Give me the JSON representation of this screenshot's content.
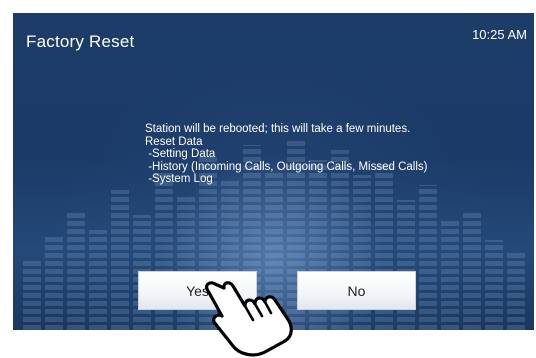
{
  "header": {
    "title": "Factory Reset",
    "time": "10:25 AM"
  },
  "message": {
    "lines": [
      "Station will be rebooted; this will take a few minutes.",
      "Reset Data",
      " -Setting Data",
      " -History (Incoming Calls, Outgoing Calls, Missed Calls)",
      " -System Log"
    ]
  },
  "buttons": {
    "yes": "Yes",
    "no": "No"
  },
  "icons": {
    "pointer": "hand-pointer-icon"
  },
  "colors": {
    "background": "#1d3c68",
    "text": "#ffffff",
    "button": "#f3f5f8"
  }
}
